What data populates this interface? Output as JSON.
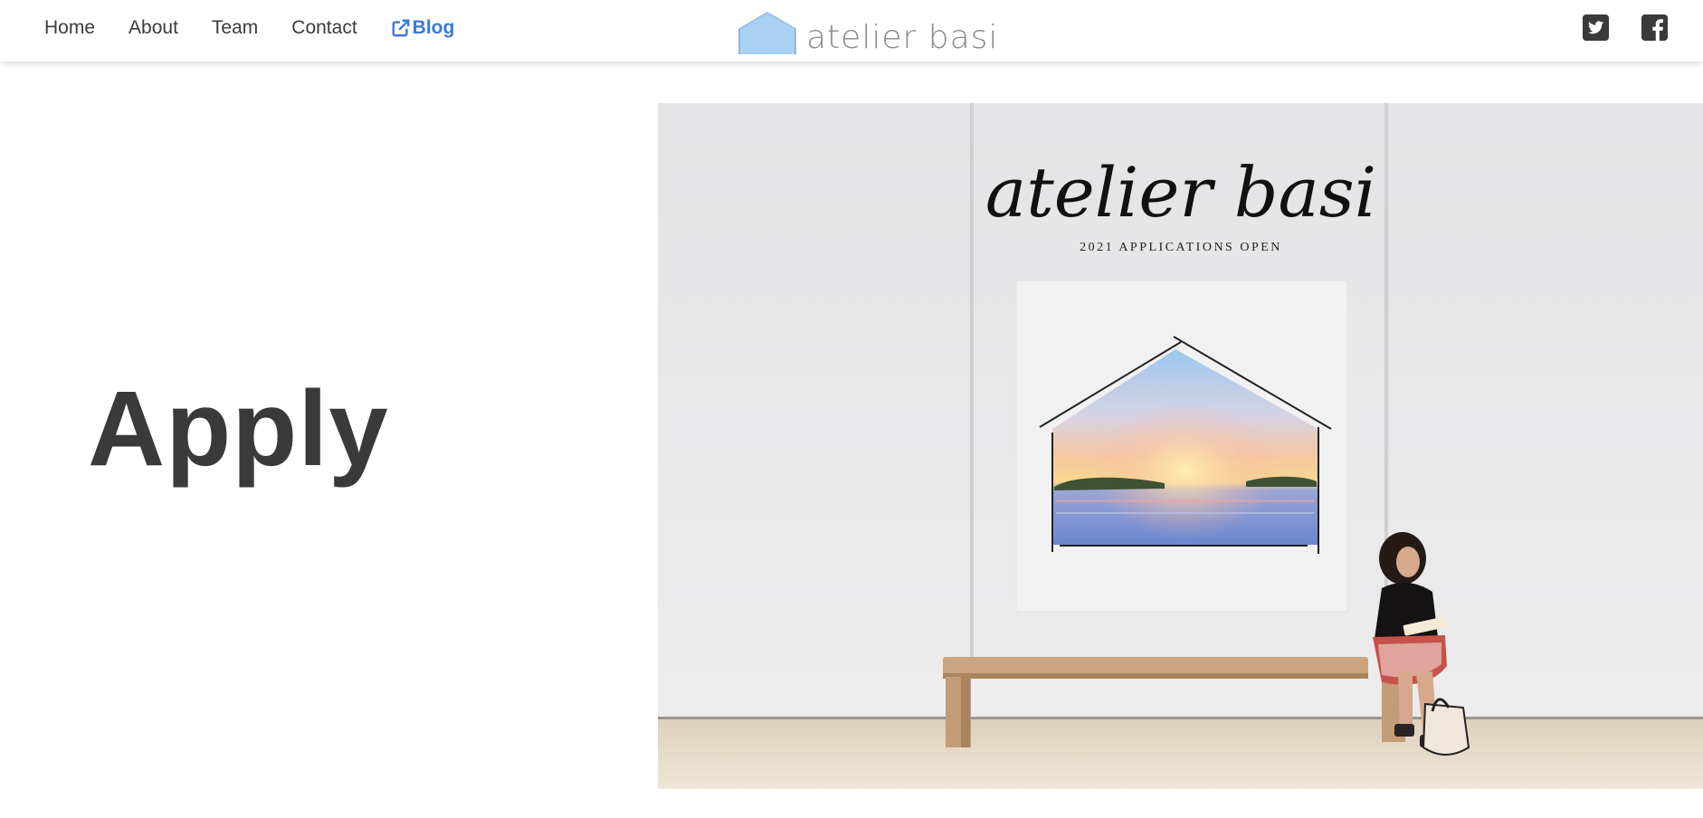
{
  "nav": {
    "links": [
      {
        "label": "Home"
      },
      {
        "label": "About"
      },
      {
        "label": "Team"
      },
      {
        "label": "Contact"
      }
    ],
    "blog_label": "Blog",
    "blog_icon": "external-link-icon"
  },
  "brand": {
    "name": "atelier basi",
    "logo_icon": "house-icon"
  },
  "social": [
    {
      "icon": "twitter-icon"
    },
    {
      "icon": "facebook-icon"
    }
  ],
  "main": {
    "title": "Apply",
    "poster": {
      "title": "atelier basi",
      "subtitle": "2021 APPLICATIONS OPEN"
    }
  },
  "colors": {
    "accent": "#3a78d6",
    "logo_blue": "#a9d1f2",
    "text_dark": "#3a3a3a",
    "hero_wall": "#e6e6e8",
    "floor": "#e8d9c6"
  }
}
